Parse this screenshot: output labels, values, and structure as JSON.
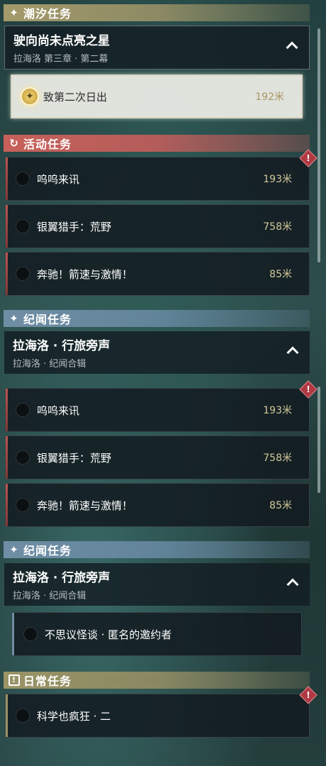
{
  "sections": {
    "tide": {
      "icon": "✦",
      "label": "潮汐任务"
    },
    "event": {
      "icon": "↻",
      "label": "活动任务"
    },
    "story1": {
      "icon": "✦",
      "label": "纪闻任务"
    },
    "story2": {
      "icon": "✦",
      "label": "纪闻任务"
    },
    "daily": {
      "icon": "!",
      "label": "日常任务"
    }
  },
  "tide_group": {
    "title": "驶向尚未点亮之星",
    "subtitle": "拉海洛 第三章 · 第二幕"
  },
  "tide_active": {
    "name": "致第二次日出",
    "distance": "192米"
  },
  "event_quests": [
    {
      "name": "呜呜来讯",
      "distance": "193米"
    },
    {
      "name": "银翼猎手：荒野",
      "distance": "758米"
    },
    {
      "name": "奔驰！箭速与激情！",
      "distance": "85米"
    }
  ],
  "story_group1": {
    "title": "拉海洛 · 行旅旁声",
    "subtitle": "拉海洛 · 纪闻合辑"
  },
  "event_quests_2": [
    {
      "name": "呜呜来讯",
      "distance": "193米"
    },
    {
      "name": "银翼猎手：荒野",
      "distance": "758米"
    },
    {
      "name": "奔驰！箭速与激情！",
      "distance": "85米"
    }
  ],
  "story_group2": {
    "title": "拉海洛 · 行旅旁声",
    "subtitle": "拉海洛 · 纪闻合辑"
  },
  "story_quest": {
    "name": "不思议怪谈 · 匿名的邀约者"
  },
  "daily_quest": {
    "name": "科学也疯狂 · 二"
  },
  "warning_mark": "!"
}
